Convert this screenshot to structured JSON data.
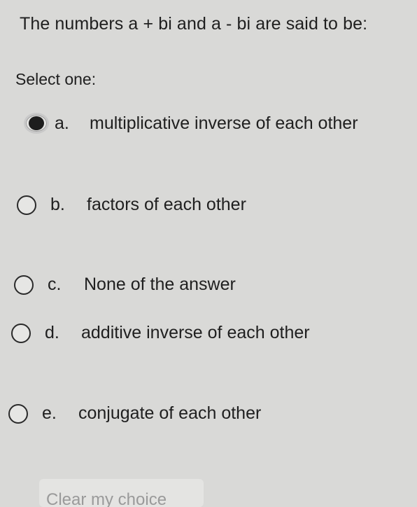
{
  "question": {
    "text": "The numbers a + bi and a - bi are said to be:"
  },
  "select_label": "Select one:",
  "options": [
    {
      "letter": "a.",
      "text": "multiplicative inverse of each other",
      "selected": true
    },
    {
      "letter": "b.",
      "text": "factors of each other",
      "selected": false
    },
    {
      "letter": "c.",
      "text": "None of the answer",
      "selected": false
    },
    {
      "letter": "d.",
      "text": "additive inverse of each other",
      "selected": false
    },
    {
      "letter": "e.",
      "text": "conjugate of each other",
      "selected": false
    }
  ],
  "clear_choice": "Clear my choice"
}
